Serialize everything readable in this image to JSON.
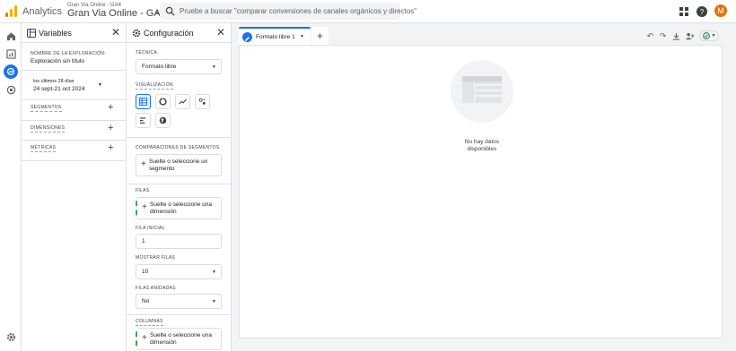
{
  "header": {
    "app_name": "Analytics",
    "property_small": "Gran Via Online - GA4",
    "property_big": "Gran Via Online - GA4",
    "search_placeholder": "Pruebe a buscar \"comparar conversiones de canales orgánicos y directos\"",
    "avatar_letter": "M"
  },
  "colors": {
    "accent": "#1a73e8",
    "logo_orange": "#f9ab00",
    "logo_dark": "#e37400",
    "avatar": "#e8710a",
    "dropzone_green": "#34a853"
  },
  "variables": {
    "title": "Variables",
    "exploration_label": "NOMBRE DE LA EXPLORACIÓN:",
    "exploration_name": "Exploración sin título",
    "date_label": "los últimos 28 días",
    "date_range": "24 sept-21 oct 2024",
    "segments": "SEGMENTOS",
    "dimensions": "DIMENSIONES",
    "metrics": "MÉTRICAS"
  },
  "config": {
    "title": "Configuración",
    "technique_label": "TÉCNICA",
    "technique_value": "Formato libre",
    "viz_label": "VISUALIZACIÓN",
    "viz_icons": [
      "table-icon",
      "donut-icon",
      "line-chart-icon",
      "scatter-icon",
      "bar-chart-icon",
      "geo-map-icon"
    ],
    "segment_compare_label": "COMPARACIONES DE SEGMENTOS",
    "segment_drop": "Suelte o seleccione un segmento",
    "rows_label": "FILAS",
    "rows_drop": "Suelte o seleccione una dimensión",
    "start_row_label": "FILA INICIAL",
    "start_row_value": "1",
    "show_rows_label": "MOSTRAR FILAS",
    "show_rows_value": "10",
    "nested_rows_label": "FILAS ANIDADAS",
    "nested_rows_value": "No",
    "columns_label": "COLUMNAS",
    "columns_drop": "Suelte o seleccione una dimensión"
  },
  "canvas": {
    "tab_label": "Formato libre 1",
    "no_data_line1": "No hay datos",
    "no_data_line2": "disponibles"
  }
}
